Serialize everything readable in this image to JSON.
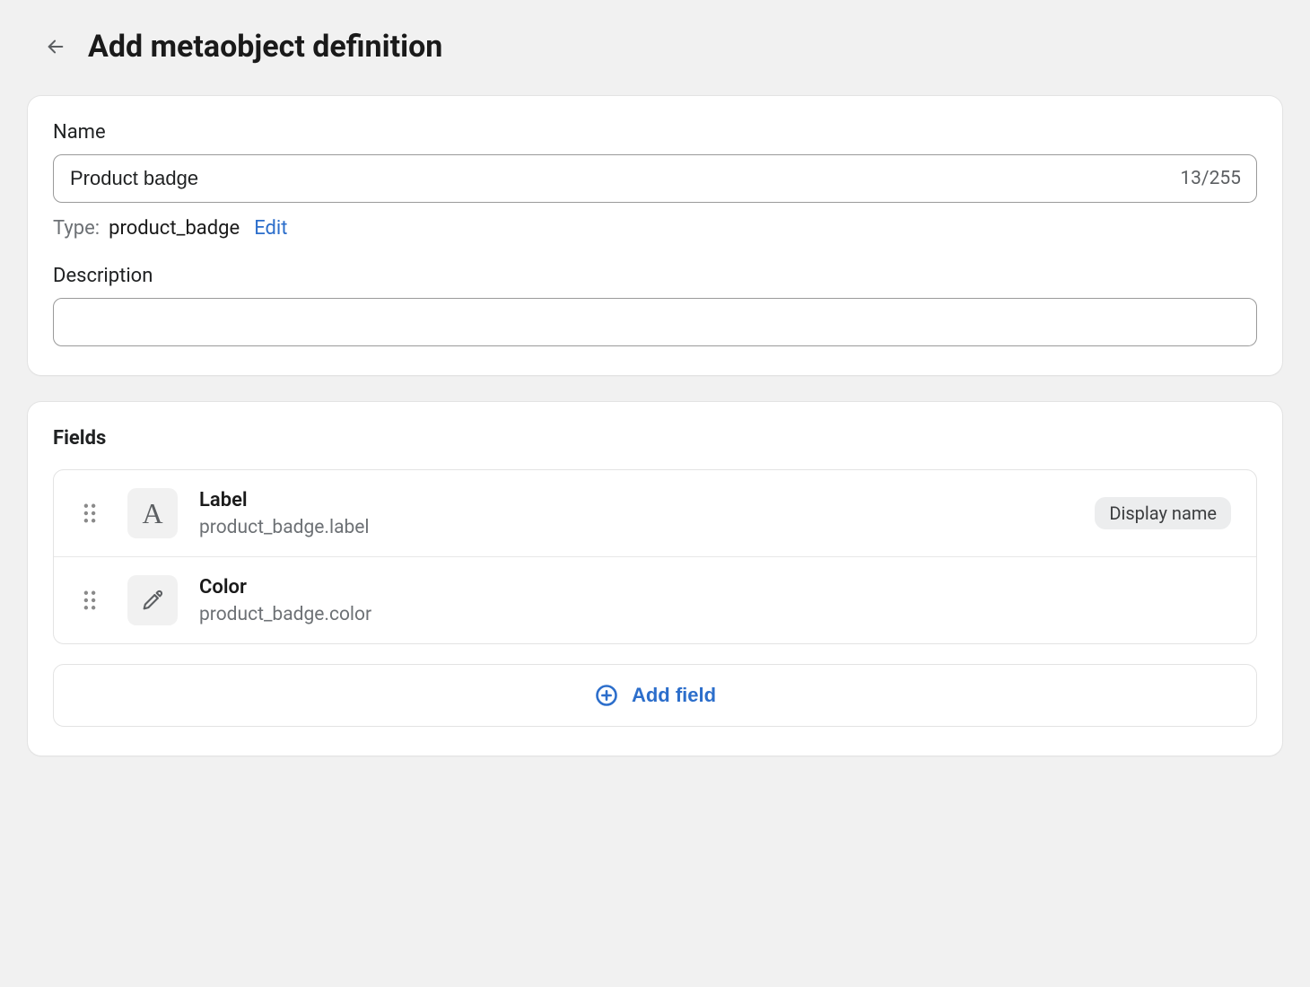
{
  "header": {
    "title": "Add metaobject definition"
  },
  "form": {
    "name_label": "Name",
    "name_value": "Product badge",
    "char_counter": "13/255",
    "type_label": "Type:",
    "type_value": "product_badge",
    "type_edit": "Edit",
    "description_label": "Description",
    "description_value": ""
  },
  "fields_section": {
    "heading": "Fields",
    "add_label": "Add field",
    "display_name_pill": "Display name",
    "items": [
      {
        "icon": "text",
        "label": "Label",
        "key": "product_badge.label",
        "display_name": true
      },
      {
        "icon": "color",
        "label": "Color",
        "key": "product_badge.color",
        "display_name": false
      }
    ]
  }
}
